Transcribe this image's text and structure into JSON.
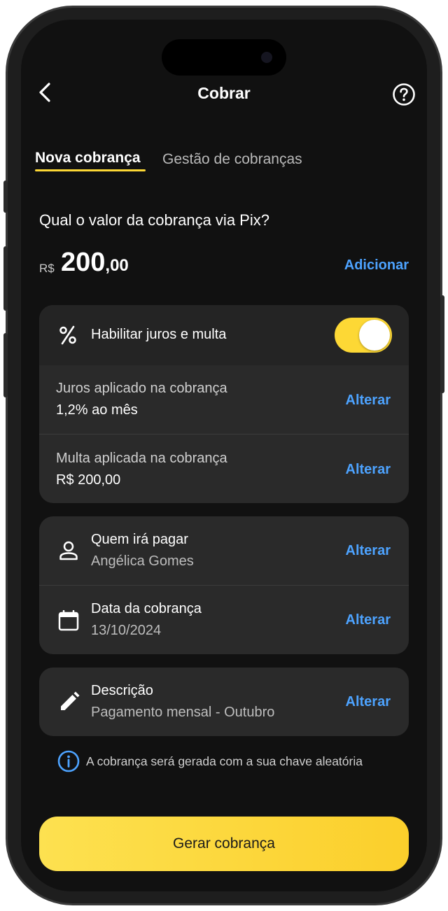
{
  "header": {
    "title": "Cobrar",
    "back_icon": "chevron-left-icon",
    "help_icon": "help-circle-icon"
  },
  "tabs": [
    {
      "label": "Nova cobrança",
      "active": true
    },
    {
      "label": "Gestão de cobranças",
      "active": false
    }
  ],
  "amount": {
    "question": "Qual o valor da cobrança via Pix?",
    "currency": "R$",
    "integer": "200",
    "cents": ",00",
    "add_label": "Adicionar"
  },
  "interest_card": {
    "toggle_icon": "percent-icon",
    "toggle_label": "Habilitar juros e multa",
    "toggle_on": true,
    "interest_label": "Juros aplicado na cobrança",
    "interest_value": "1,2% ao mês",
    "interest_action": "Alterar",
    "fine_label": "Multa aplicada na cobrança",
    "fine_value": "R$ 200,00",
    "fine_action": "Alterar"
  },
  "payer_card": {
    "payer_label": "Quem irá pagar",
    "payer_value": "Angélica Gomes",
    "payer_action": "Alterar",
    "payer_icon": "person-icon",
    "date_label": "Data da cobrança",
    "date_value": "13/10/2024",
    "date_action": "Alterar",
    "date_icon": "calendar-icon"
  },
  "description_card": {
    "label": "Descrição",
    "value": "Pagamento mensal - Outubro",
    "action": "Alterar",
    "icon": "pencil-icon"
  },
  "info": {
    "icon": "info-icon",
    "text": "A cobrança será gerada com a sua chave aleatória"
  },
  "cta": {
    "label": "Gerar cobrança"
  },
  "colors": {
    "accent": "#fdd835",
    "link": "#4da3ff",
    "background": "#111111",
    "card": "#2a2a2a"
  }
}
